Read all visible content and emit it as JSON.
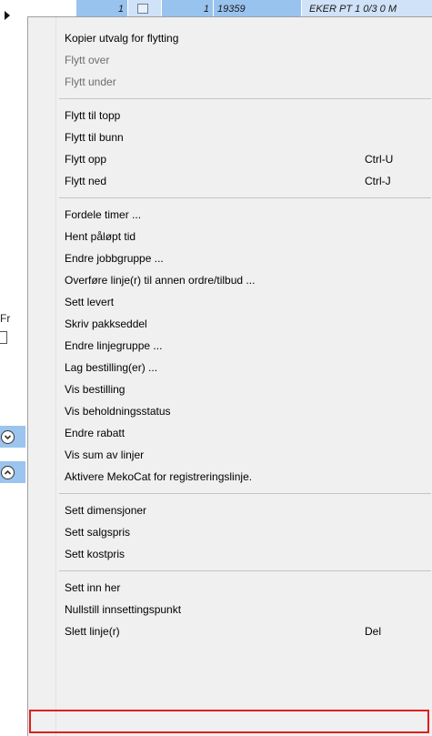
{
  "background": {
    "grid_row": {
      "cell_a": "1",
      "cell_b": "1",
      "cell_c": "19359",
      "cell_d": "EKER PT 1 0/3 0 M"
    },
    "form_label_partial": "Fr"
  },
  "context_menu": {
    "items": [
      {
        "label": "Kopier utvalg for flytting",
        "shortcut": "",
        "enabled": true
      },
      {
        "label": "Flytt over",
        "shortcut": "",
        "enabled": false
      },
      {
        "label": "Flytt under",
        "shortcut": "",
        "enabled": false
      },
      {
        "label": "Flytt til topp",
        "shortcut": "",
        "enabled": true
      },
      {
        "label": "Flytt til bunn",
        "shortcut": "",
        "enabled": true
      },
      {
        "label": "Flytt opp",
        "shortcut": "Ctrl-U",
        "enabled": true
      },
      {
        "label": "Flytt ned",
        "shortcut": "Ctrl-J",
        "enabled": true
      },
      {
        "label": "Fordele timer ...",
        "shortcut": "",
        "enabled": true
      },
      {
        "label": "Hent påløpt tid",
        "shortcut": "",
        "enabled": true
      },
      {
        "label": "Endre jobbgruppe ...",
        "shortcut": "",
        "enabled": true
      },
      {
        "label": "Overføre linje(r) til annen ordre/tilbud ...",
        "shortcut": "",
        "enabled": true
      },
      {
        "label": "Sett levert",
        "shortcut": "",
        "enabled": true
      },
      {
        "label": "Skriv pakkseddel",
        "shortcut": "",
        "enabled": true
      },
      {
        "label": "Endre linjegruppe ...",
        "shortcut": "",
        "enabled": true
      },
      {
        "label": "Lag bestilling(er) ...",
        "shortcut": "",
        "enabled": true
      },
      {
        "label": "Vis bestilling",
        "shortcut": "",
        "enabled": true
      },
      {
        "label": "Vis beholdningsstatus",
        "shortcut": "",
        "enabled": true
      },
      {
        "label": "Endre rabatt",
        "shortcut": "",
        "enabled": true
      },
      {
        "label": "Vis sum av linjer",
        "shortcut": "",
        "enabled": true
      },
      {
        "label": "Aktivere MekoCat for registreringslinje.",
        "shortcut": "",
        "enabled": true
      },
      {
        "label": "Sett dimensjoner",
        "shortcut": "",
        "enabled": true
      },
      {
        "label": "Sett salgspris",
        "shortcut": "",
        "enabled": true
      },
      {
        "label": "Sett kostpris",
        "shortcut": "",
        "enabled": true
      },
      {
        "label": "Sett inn her",
        "shortcut": "",
        "enabled": true
      },
      {
        "label": "Nullstill innsettingspunkt",
        "shortcut": "",
        "enabled": true
      },
      {
        "label": "Slett linje(r)",
        "shortcut": "Del",
        "enabled": true
      }
    ],
    "highlighted_item": "Slett linje(r)",
    "colors": {
      "menu_background": "#f0f0f0",
      "disabled_text": "#6d6d6d",
      "highlight_border": "#e01e1e",
      "selection_blue": "#99c3ef"
    }
  }
}
